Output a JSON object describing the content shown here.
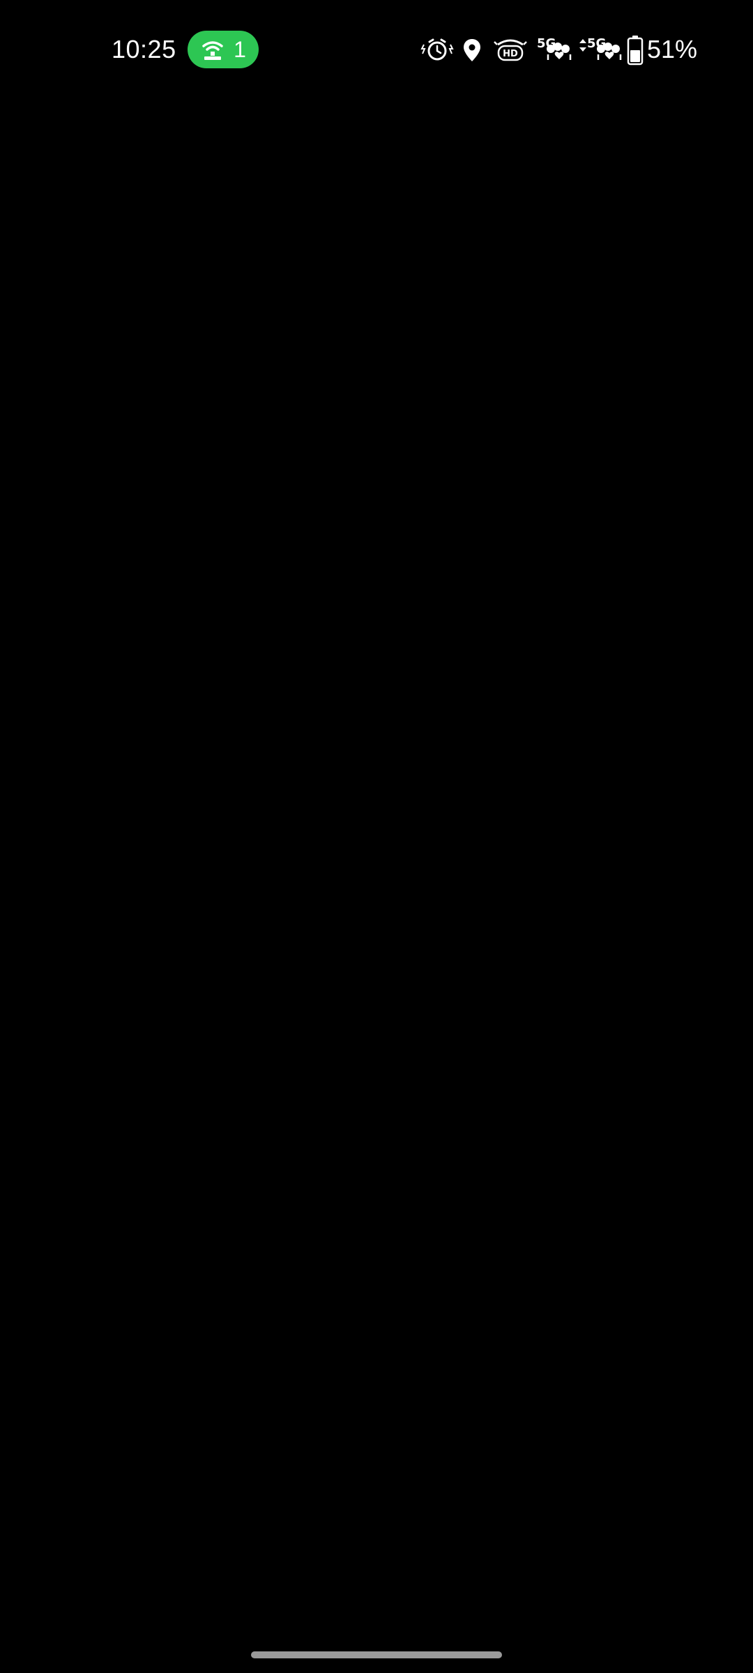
{
  "status_bar": {
    "time": "10:25",
    "hotspot_count": "1",
    "hotspot_color": "#2dc653",
    "net1_label": "5G",
    "net2_label": "5G",
    "battery_percent": "51%",
    "battery_level": 0.51,
    "icons": [
      "hotspot-icon",
      "alarm-icon",
      "location-icon",
      "hd-voice-icon",
      "signal-icon",
      "data-arrows-icon",
      "battery-icon"
    ]
  }
}
